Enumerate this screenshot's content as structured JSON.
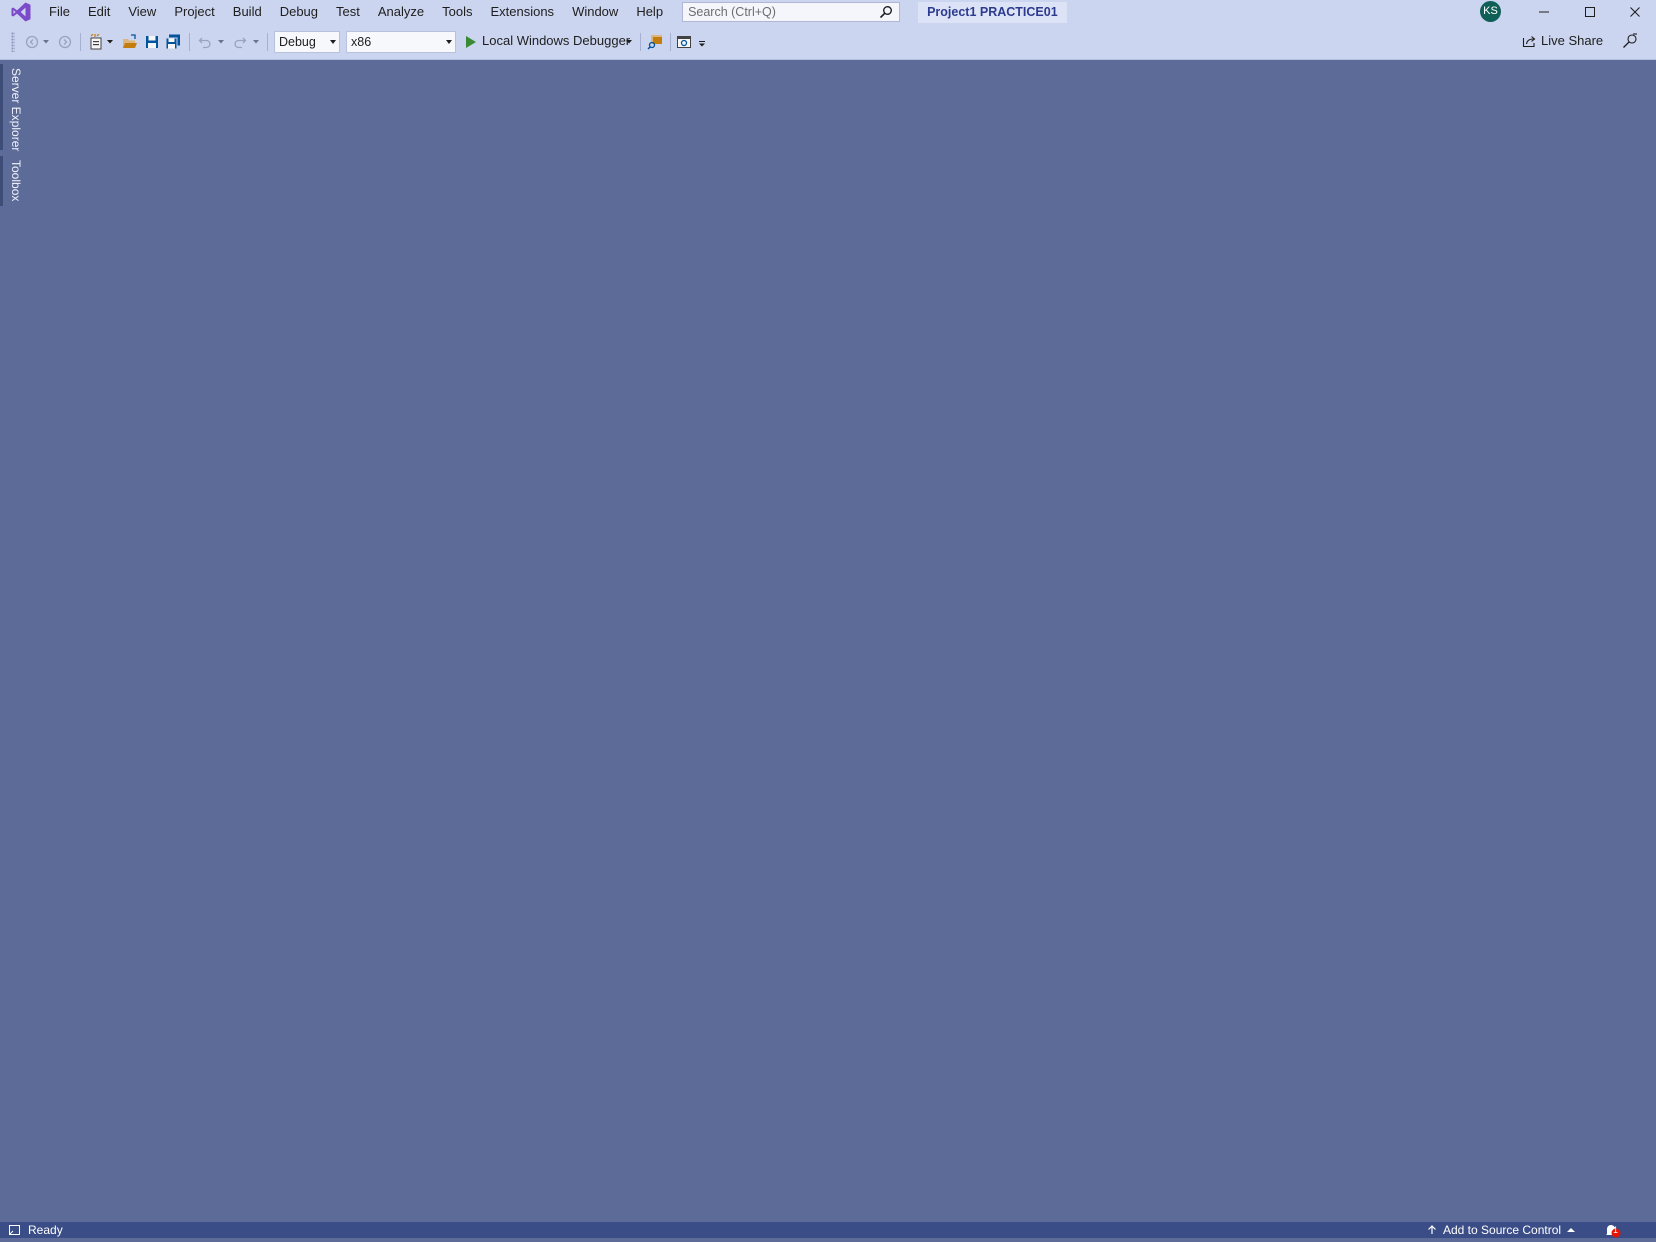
{
  "menu": {
    "items": [
      {
        "label": "File"
      },
      {
        "label": "Edit"
      },
      {
        "label": "View"
      },
      {
        "label": "Project"
      },
      {
        "label": "Build"
      },
      {
        "label": "Debug"
      },
      {
        "label": "Test"
      },
      {
        "label": "Analyze"
      },
      {
        "label": "Tools"
      },
      {
        "label": "Extensions"
      },
      {
        "label": "Window"
      },
      {
        "label": "Help"
      }
    ]
  },
  "search": {
    "placeholder": "Search (Ctrl+Q)"
  },
  "solution_title": "Project1 PRACTICE01",
  "account": {
    "initials": "KS",
    "color": "#0f5f57"
  },
  "toolbar": {
    "configuration": "Debug",
    "platform": "x86",
    "run_label": "Local Windows Debugger",
    "live_share_label": "Live Share"
  },
  "side_tabs": {
    "server_explorer": "Server Explorer",
    "toolbox": "Toolbox"
  },
  "status": {
    "ready": "Ready",
    "source_control": "Add to Source Control",
    "notification_count": "1"
  },
  "colors": {
    "chrome": "#ccd5f0",
    "workspace": "#5c6b98",
    "statusbar": "#3b4d86",
    "accent": "#68217a"
  }
}
